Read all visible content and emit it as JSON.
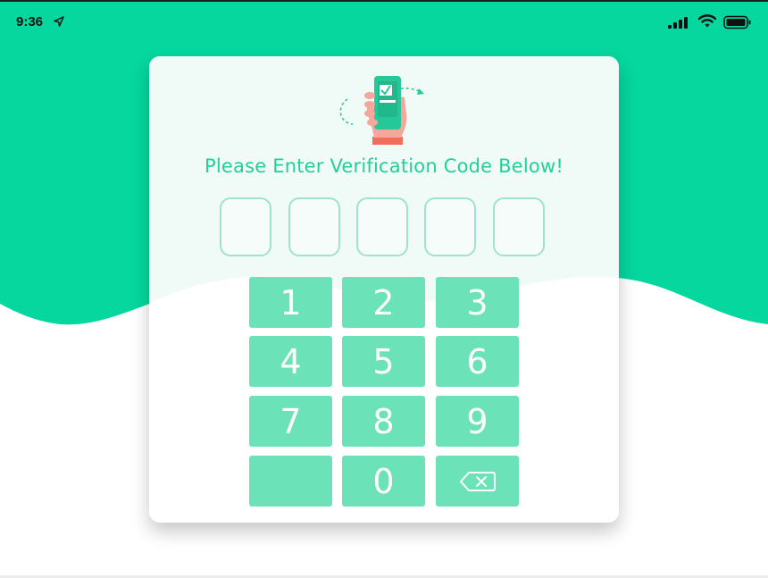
{
  "status_bar": {
    "time": "9:36",
    "icons": [
      "location-arrow-icon",
      "cellular-signal-icon",
      "wifi-icon",
      "battery-icon"
    ]
  },
  "colors": {
    "brand_green": "#05d79e",
    "title_green": "#23cf98",
    "key_green": "#6ce2b9",
    "box_border": "#9fe3cc",
    "phone_green": "#26c89a",
    "hand_skin": "#f4a79a",
    "sleeve": "#f26d5b"
  },
  "verification": {
    "title": "Please Enter Verification Code Below!",
    "code_boxes": [
      "",
      "",
      "",
      "",
      ""
    ]
  },
  "keypad": {
    "keys": [
      {
        "label": "1"
      },
      {
        "label": "2"
      },
      {
        "label": "3"
      },
      {
        "label": "4"
      },
      {
        "label": "5"
      },
      {
        "label": "6"
      },
      {
        "label": "7"
      },
      {
        "label": "8"
      },
      {
        "label": "9"
      },
      {
        "label": ""
      },
      {
        "label": "0"
      },
      {
        "label": "",
        "icon": "backspace-icon"
      }
    ]
  }
}
